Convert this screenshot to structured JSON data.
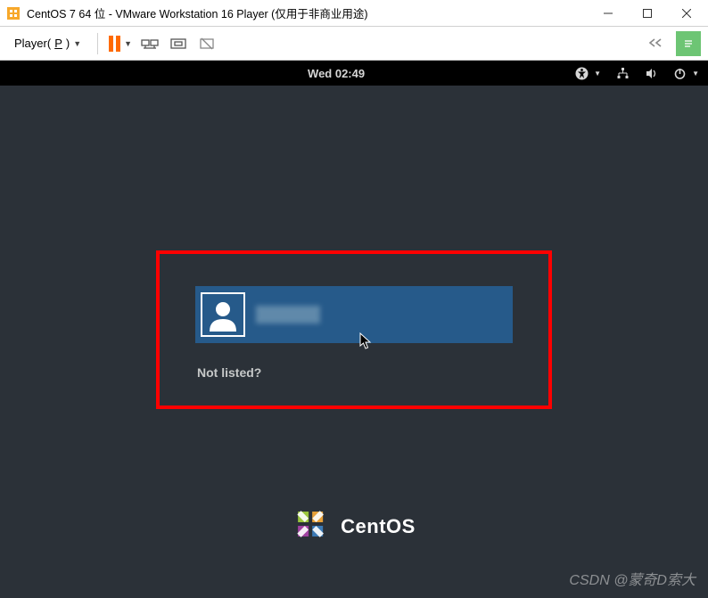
{
  "window": {
    "title": "CentOS 7 64 位 - VMware Workstation 16 Player (仅用于非商业用途)"
  },
  "toolbar": {
    "player_label_prefix": "Player(",
    "player_accel": "P",
    "player_label_suffix": ")"
  },
  "gnome": {
    "clock": "Wed 02:49"
  },
  "login": {
    "not_listed": "Not listed?"
  },
  "brand": {
    "name": "CentOS"
  },
  "watermark": {
    "text": "CSDN @蒙奇D索大"
  }
}
